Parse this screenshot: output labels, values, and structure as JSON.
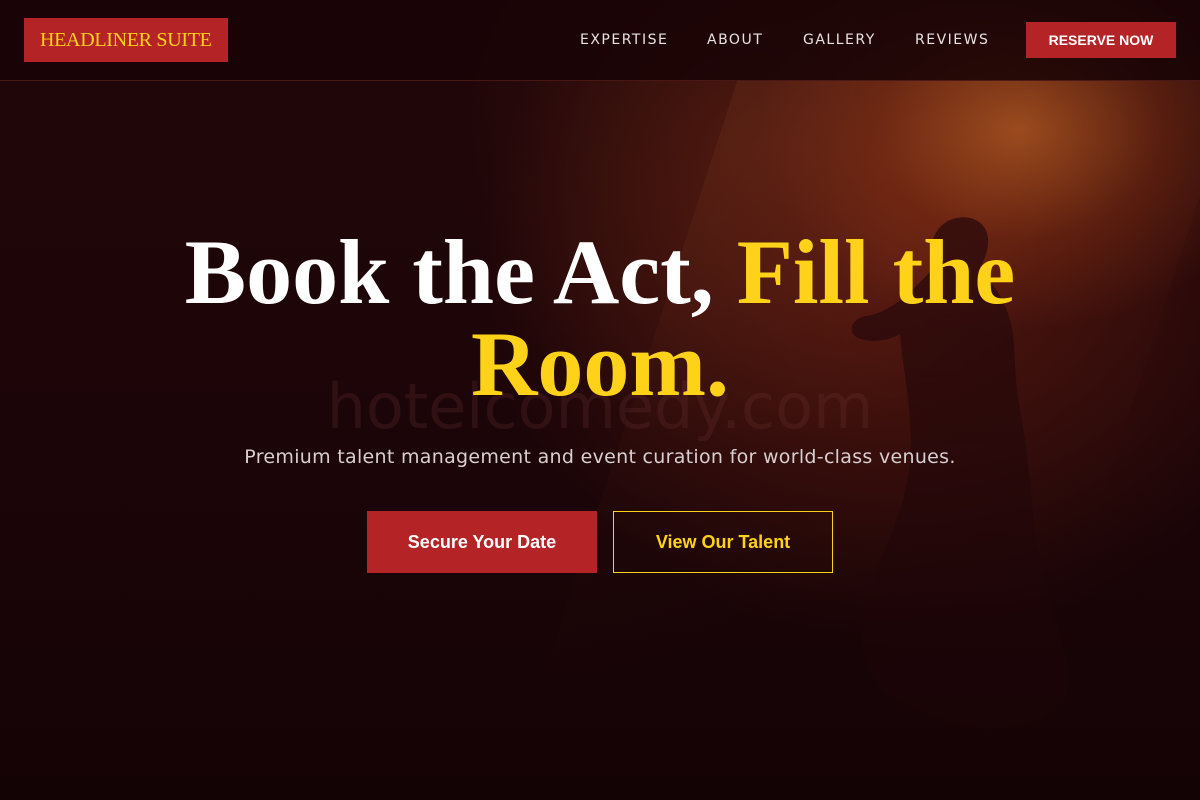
{
  "header": {
    "logo_text": "HEADLINER SUITE",
    "nav": [
      {
        "label": "EXPERTISE"
      },
      {
        "label": "ABOUT"
      },
      {
        "label": "GALLERY"
      },
      {
        "label": "REVIEWS"
      }
    ],
    "cta_label": "RESERVE NOW"
  },
  "hero": {
    "title_part1": "Book the Act, ",
    "title_part2": "Fill the Room.",
    "watermark": "hotelcomedy.com",
    "subtitle": "Premium talent management and event curation for world-class venues.",
    "primary_button": "Secure Your Date",
    "secondary_button": "View Our Talent"
  },
  "colors": {
    "accent_red": "#b42325",
    "accent_gold": "#ffd21a",
    "background": "#1a0407"
  }
}
